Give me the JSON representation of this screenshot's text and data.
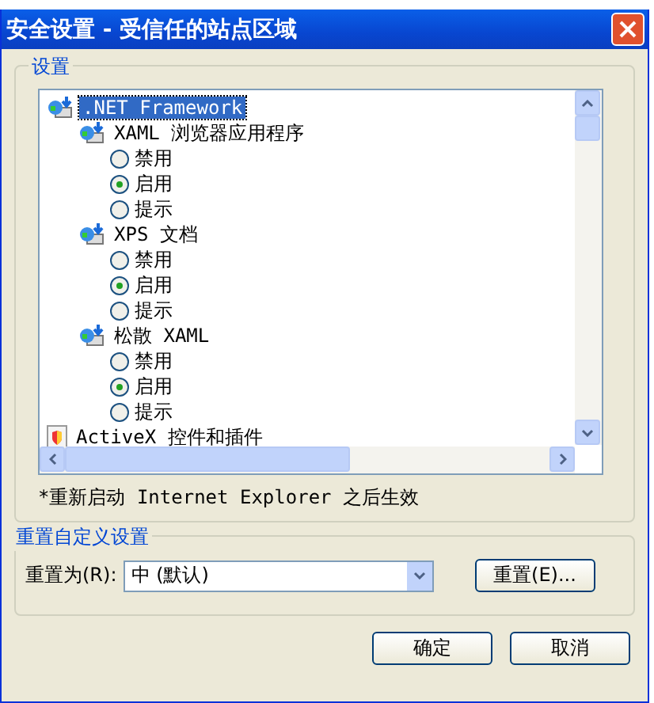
{
  "window": {
    "title": "安全设置 - 受信任的站点区域"
  },
  "settings_group": {
    "label": "设置",
    "tree": [
      {
        "label": ".NET Framework",
        "selected": true,
        "kind": "framework",
        "children": [
          {
            "label": "XAML 浏览器应用程序",
            "selected": false,
            "kind": "framework",
            "children": [
              {
                "kind": "radio",
                "label": "禁用",
                "selected": false
              },
              {
                "kind": "radio",
                "label": "启用",
                "selected": true
              },
              {
                "kind": "radio",
                "label": "提示",
                "selected": false
              }
            ]
          },
          {
            "label": "XPS 文档",
            "selected": false,
            "kind": "framework",
            "children": [
              {
                "kind": "radio",
                "label": "禁用",
                "selected": false
              },
              {
                "kind": "radio",
                "label": "启用",
                "selected": true
              },
              {
                "kind": "radio",
                "label": "提示",
                "selected": false
              }
            ]
          },
          {
            "label": "松散 XAML",
            "selected": false,
            "kind": "framework",
            "children": [
              {
                "kind": "radio",
                "label": "禁用",
                "selected": false
              },
              {
                "kind": "radio",
                "label": "启用",
                "selected": true
              },
              {
                "kind": "radio",
                "label": "提示",
                "selected": false
              }
            ]
          }
        ]
      },
      {
        "label": "ActiveX 控件和插件",
        "selected": false,
        "kind": "addon"
      }
    ],
    "note": "*重新启动 Internet Explorer 之后生效"
  },
  "reset_group": {
    "label": "重置自定义设置",
    "reset_to_label": "重置为(R):",
    "reset_to_value": "中 (默认)",
    "reset_button": "重置(E)..."
  },
  "buttons": [
    "确定",
    "取消"
  ]
}
